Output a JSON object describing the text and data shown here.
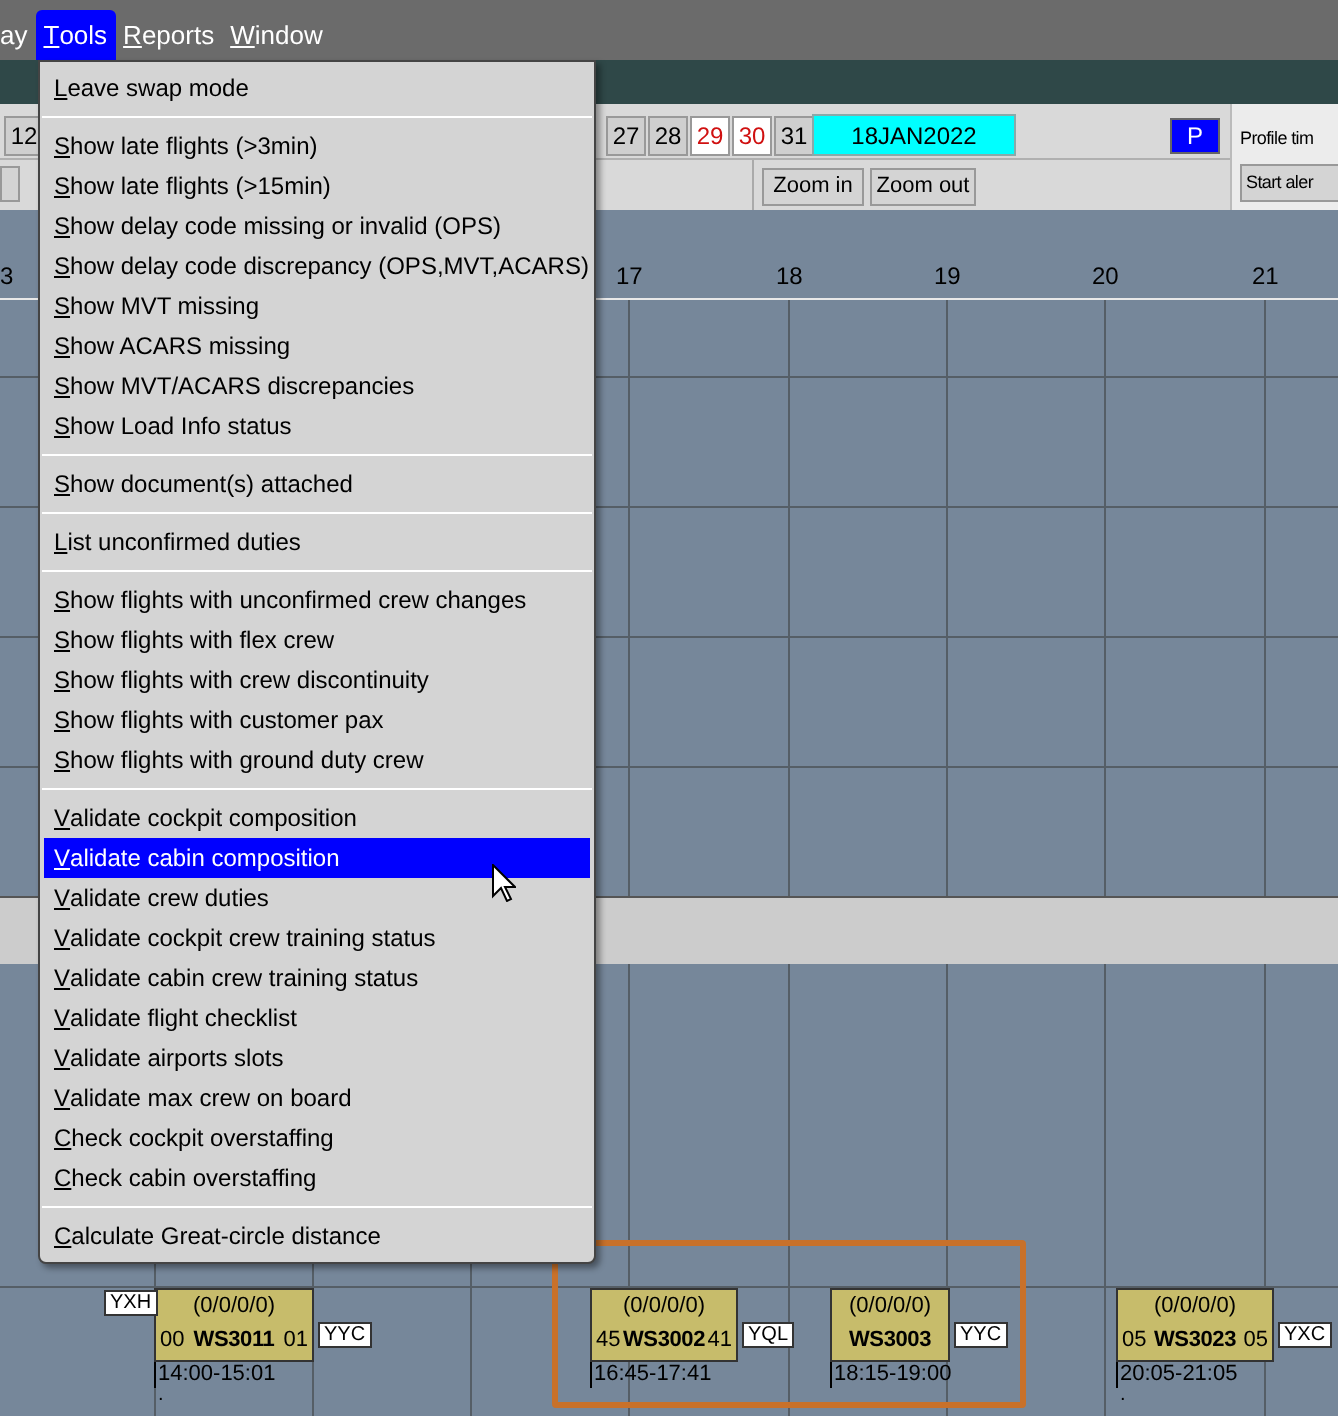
{
  "menubar": [
    {
      "label": "ay",
      "mnemonic": false,
      "selected": false
    },
    {
      "label": "Tools",
      "mnemonic": true,
      "selected": true
    },
    {
      "label": "Reports",
      "mnemonic": true,
      "selected": false
    },
    {
      "label": "Window",
      "mnemonic": true,
      "selected": false
    }
  ],
  "toolbar": {
    "day_cells": [
      {
        "label": "12",
        "weekend": false
      },
      {
        "label": "27",
        "weekend": false
      },
      {
        "label": "28",
        "weekend": false
      },
      {
        "label": "29",
        "weekend": true
      },
      {
        "label": "30",
        "weekend": true
      },
      {
        "label": "31",
        "weekend": false
      }
    ],
    "date": "18JAN2022",
    "p_button": "P",
    "profile_label": "Profile tim",
    "zoom_in": "Zoom in",
    "zoom_out": "Zoom out",
    "alert_button": "Start aler"
  },
  "hour_labels": [
    "3",
    "17",
    "18",
    "19",
    "20",
    "21"
  ],
  "tools_menu": [
    [
      {
        "label": "Leave swap mode",
        "selected": false
      }
    ],
    [
      {
        "label": "Show late flights (>3min)",
        "selected": false
      },
      {
        "label": "Show late flights (>15min)",
        "selected": false
      },
      {
        "label": "Show delay code missing or invalid (OPS)",
        "selected": false
      },
      {
        "label": "Show delay code discrepancy (OPS,MVT,ACARS)",
        "selected": false
      },
      {
        "label": "Show MVT missing",
        "selected": false
      },
      {
        "label": "Show ACARS missing",
        "selected": false
      },
      {
        "label": "Show MVT/ACARS discrepancies",
        "selected": false
      },
      {
        "label": "Show Load Info status",
        "selected": false
      }
    ],
    [
      {
        "label": "Show document(s) attached",
        "selected": false
      }
    ],
    [
      {
        "label": "List unconfirmed duties",
        "selected": false
      }
    ],
    [
      {
        "label": "Show flights with unconfirmed crew changes",
        "selected": false
      },
      {
        "label": "Show flights with flex crew",
        "selected": false
      },
      {
        "label": "Show flights with crew discontinuity",
        "selected": false
      },
      {
        "label": "Show flights with customer pax",
        "selected": false
      },
      {
        "label": "Show flights with ground duty crew",
        "selected": false
      }
    ],
    [
      {
        "label": "Validate cockpit composition",
        "selected": false
      },
      {
        "label": "Validate cabin composition",
        "selected": true
      },
      {
        "label": "Validate crew duties",
        "selected": false
      },
      {
        "label": "Validate cockpit crew training status",
        "selected": false
      },
      {
        "label": "Validate cabin crew training status",
        "selected": false
      },
      {
        "label": "Validate flight checklist",
        "selected": false
      },
      {
        "label": "Validate airports slots",
        "selected": false
      },
      {
        "label": "Validate max crew on board",
        "selected": false
      },
      {
        "label": "Check cockpit overstaffing",
        "selected": false
      },
      {
        "label": "Check cabin overstaffing",
        "selected": false
      }
    ],
    [
      {
        "label": "Calculate Great-circle distance",
        "selected": false
      }
    ]
  ],
  "flights": [
    {
      "origin": "YXH",
      "crew": "(0/0/0/0)",
      "dep": "00",
      "number": "WS3011",
      "arr": "01",
      "destination": "YYC",
      "time": "14:00-15:01",
      "note": ".",
      "highlighted": false
    },
    {
      "crew": "(0/0/0/0)",
      "dep": "45",
      "number": "WS3002",
      "arr": "41",
      "destination": "YQL",
      "time": "16:45-17:41",
      "highlighted": true
    },
    {
      "crew": "(0/0/0/0)",
      "number": "WS3003",
      "destination": "YYC",
      "time": "18:15-19:00",
      "highlighted": true
    },
    {
      "crew": "(0/0/0/0)",
      "dep": "05",
      "number": "WS3023",
      "arr": "05",
      "destination": "YXC",
      "time": "20:05-21:05",
      "note": ".",
      "highlighted": false
    }
  ]
}
